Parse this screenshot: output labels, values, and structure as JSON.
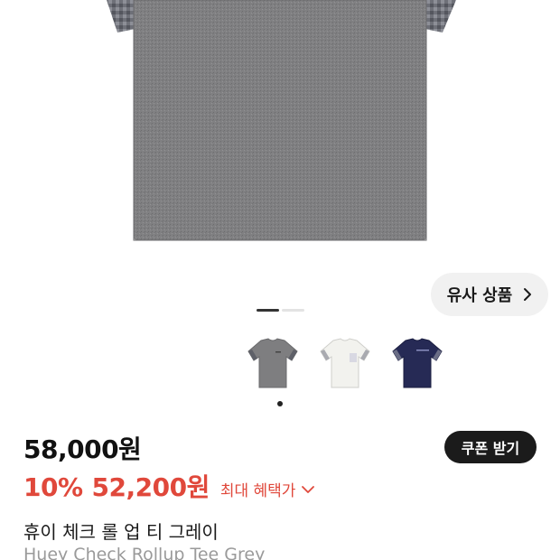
{
  "similar": {
    "label": "유사 상품",
    "icon": "chevron-right-icon"
  },
  "gallery": {
    "slides_total": 2,
    "slide_active": 1,
    "thumbnails": [
      {
        "color": "grey",
        "hex": "#7e7e80",
        "icon": "tshirt-grey-icon"
      },
      {
        "color": "white",
        "hex": "#f2f2ee",
        "icon": "tshirt-white-icon"
      },
      {
        "color": "navy",
        "hex": "#262a55",
        "icon": "tshirt-navy-icon"
      }
    ],
    "selected_thumbnail": 0
  },
  "price": {
    "original": "58,000원",
    "discount": "10%",
    "sale": "52,200원",
    "benefit_label": "최대 혜택가",
    "accent_color": "#e0483b"
  },
  "coupon": {
    "label": "쿠폰 받기"
  },
  "product": {
    "name_ko": "휴이 체크 롤 업 티 그레이",
    "name_en": "Huey Check Rollup Tee Grey"
  }
}
